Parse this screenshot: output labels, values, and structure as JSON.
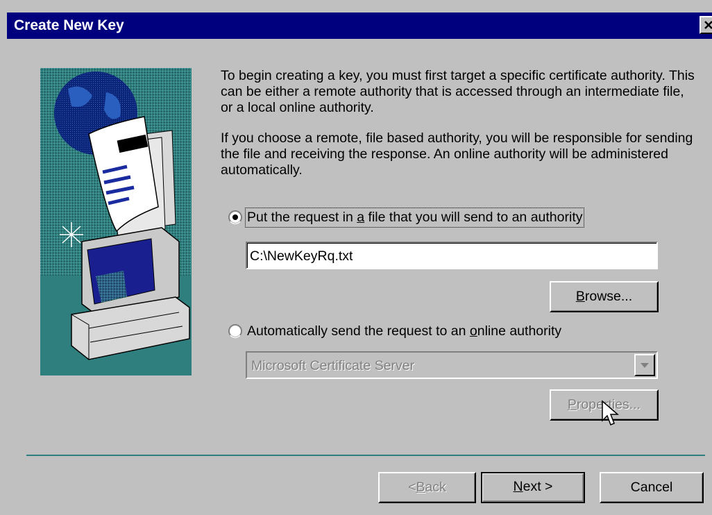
{
  "window": {
    "title": "Create New Key",
    "close_label": "Close"
  },
  "intro": {
    "paragraph1": "To begin creating a key, you must first target a specific certificate authority. This can be either a remote authority that is accessed through an intermediate file, or a local online authority.",
    "paragraph2": "If you choose a remote, file based authority, you will be responsible for sending the file and receiving the response. An online authority will be administered automatically."
  },
  "options": {
    "file_option": {
      "pre": "Put the request in ",
      "mnemonic": "a",
      "post": " file that you will send to an authority",
      "selected": true
    },
    "file_path_value": "C:\\NewKeyRq.txt",
    "browse_button": {
      "mnemonic": "B",
      "rest": "rowse..."
    },
    "online_option": {
      "pre": "Automatically send the request to an ",
      "mnemonic": "o",
      "post": "nline authority",
      "selected": false
    },
    "authority_select_value": "Microsoft Certificate Server",
    "properties_button": {
      "mnemonic": "P",
      "rest": "roperties..."
    }
  },
  "footer": {
    "back_button": {
      "pre": "< ",
      "mnemonic": "B",
      "rest": "ack"
    },
    "next_button": {
      "mnemonic": "N",
      "rest": "ext >"
    },
    "cancel_button": "Cancel"
  },
  "colors": {
    "titlebar": "#00007f",
    "face": "#c0c0c0",
    "accent": "#2f7f7f"
  }
}
